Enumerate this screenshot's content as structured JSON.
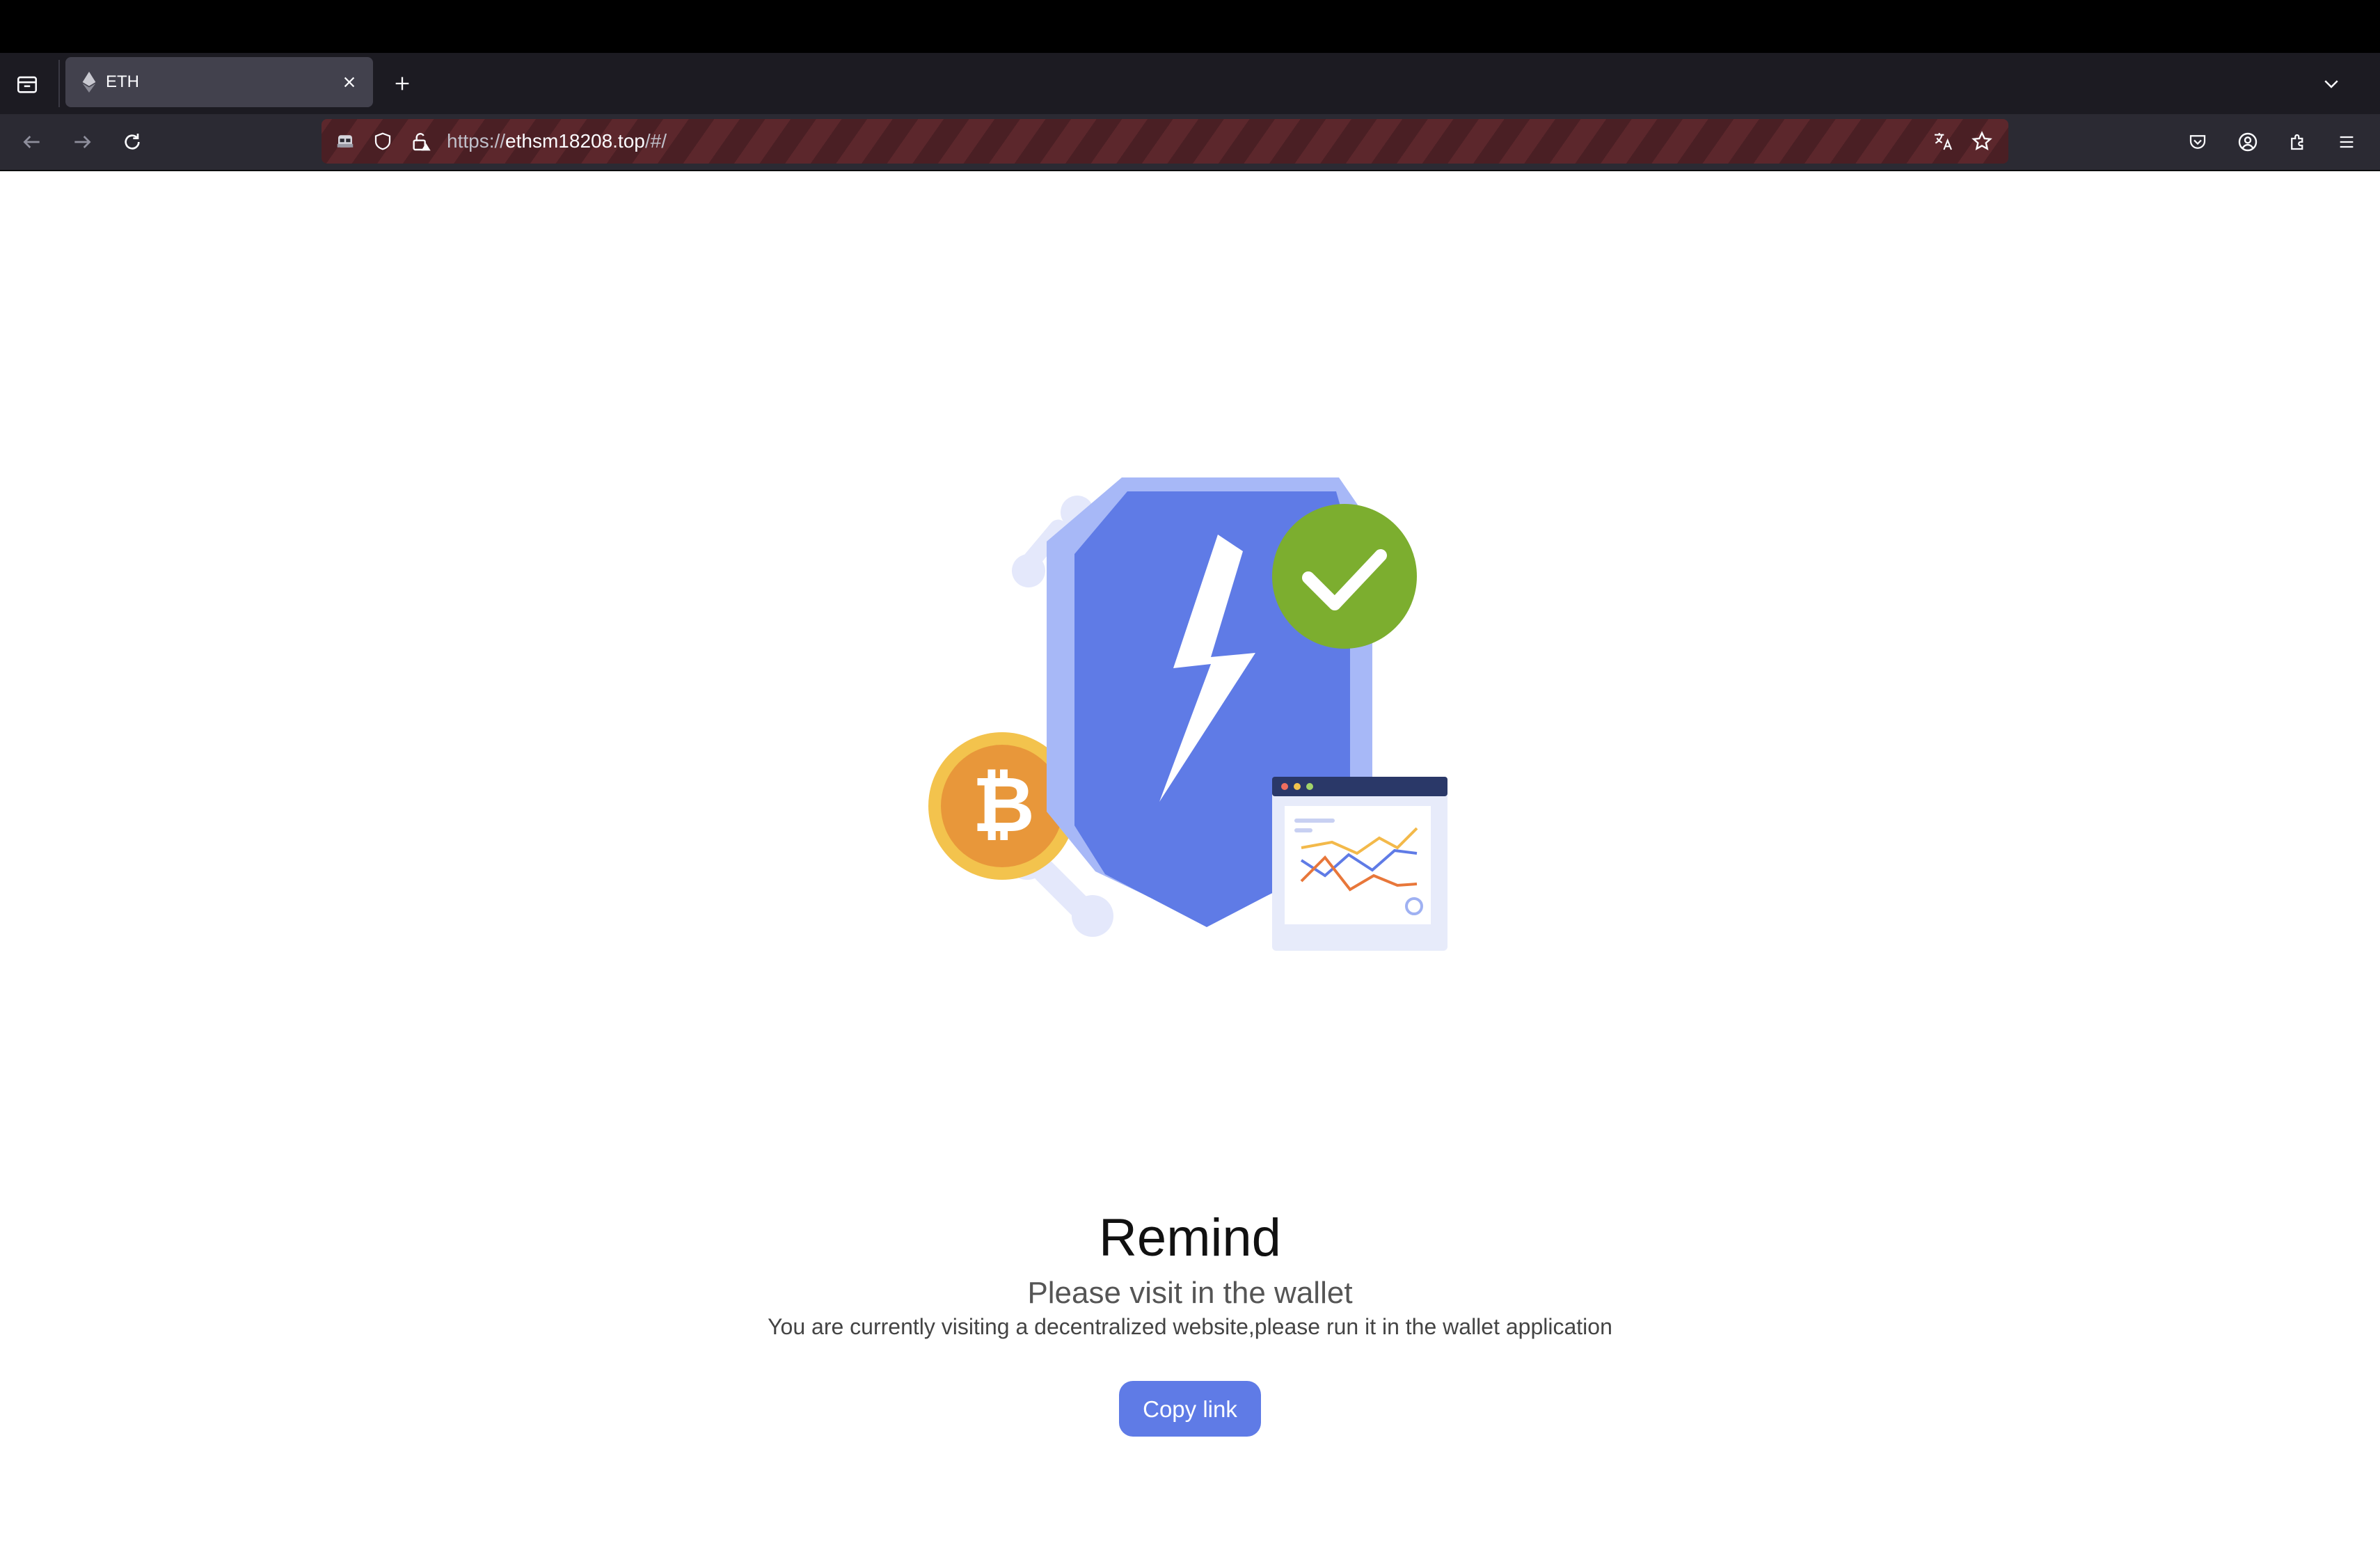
{
  "browser": {
    "tab": {
      "title": "ETH",
      "close_icon": "close-icon"
    },
    "address": {
      "url_prefix": "https://",
      "url_host": "ethsm18208.top",
      "url_path": "/#/"
    },
    "colors": {
      "tab_bg": "#42414d",
      "urlbar_stripe": "#4a1f24"
    }
  },
  "page": {
    "title": "Remind",
    "subtitle": "Please visit in the wallet",
    "description": "You are currently visiting a decentralized website,please run it in the wallet application",
    "button_label": "Copy link",
    "colors": {
      "button": "#5f7be6",
      "shield": "#5f7be6",
      "check": "#7cae2f",
      "coin": "#e8973a"
    }
  }
}
